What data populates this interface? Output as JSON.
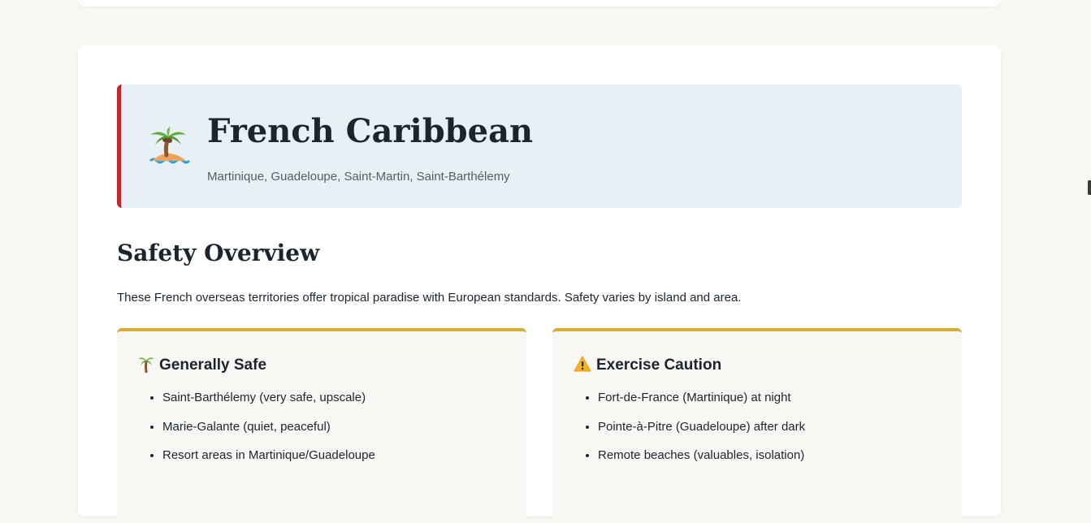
{
  "region": {
    "title": "French Caribbean",
    "subtitle": "Martinique, Guadeloupe, Saint-Martin, Saint-Barthélemy",
    "icon": "desert-island-icon"
  },
  "overview": {
    "heading": "Safety Overview",
    "description": "These French overseas territories offer tropical paradise with European standards. Safety varies by island and area."
  },
  "safe_box": {
    "icon": "palm-tree-icon",
    "title": "Generally Safe",
    "items": [
      "Saint-Barthélemy (very safe, upscale)",
      "Marie-Galante (quiet, peaceful)",
      "Resort areas in Martinique/Guadeloupe"
    ]
  },
  "caution_box": {
    "icon": "warning-icon",
    "title": "Exercise Caution",
    "items": [
      "Fort-de-France (Martinique) at night",
      "Pointe-à-Pitre (Guadeloupe) after dark",
      "Remote beaches (valuables, isolation)"
    ]
  },
  "colors": {
    "page_background": "#f8f7f3",
    "hero_background": "#e8f0f6",
    "hero_accent": "#c0272d",
    "box_accent": "#d8ad35",
    "text_primary": "#1c2430"
  }
}
